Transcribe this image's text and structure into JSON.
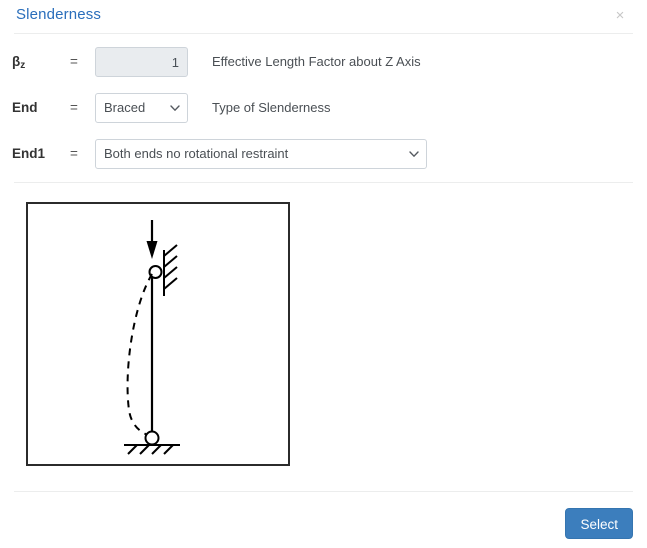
{
  "header": {
    "title": "Slenderness",
    "close_label": "×"
  },
  "form": {
    "rows": [
      {
        "label": "β",
        "label_sub": "z",
        "equals": "=",
        "value": "1",
        "hint": "Effective Length Factor about Z Axis"
      },
      {
        "label": "End",
        "label_sub": "",
        "equals": "=",
        "value": "Braced",
        "hint": "Type of Slenderness"
      },
      {
        "label": "End1",
        "label_sub": "",
        "equals": "=",
        "value": "Both ends no rotational restraint",
        "hint": ""
      }
    ]
  },
  "diagram": {
    "name": "buckling-mode-diagram",
    "description": "Column with pinned base and laterally braced pinned top, axial load arrow at top, dashed buckled shape",
    "stroke_color": "#000000",
    "border_color": "#2b2b2b"
  },
  "footer": {
    "select_label": "Select"
  },
  "colors": {
    "title_blue": "#2a6ebb",
    "button_blue": "#3c7ebd",
    "divider": "#eceded",
    "input_disabled_bg": "#e9ecef",
    "input_border": "#ced4da"
  }
}
